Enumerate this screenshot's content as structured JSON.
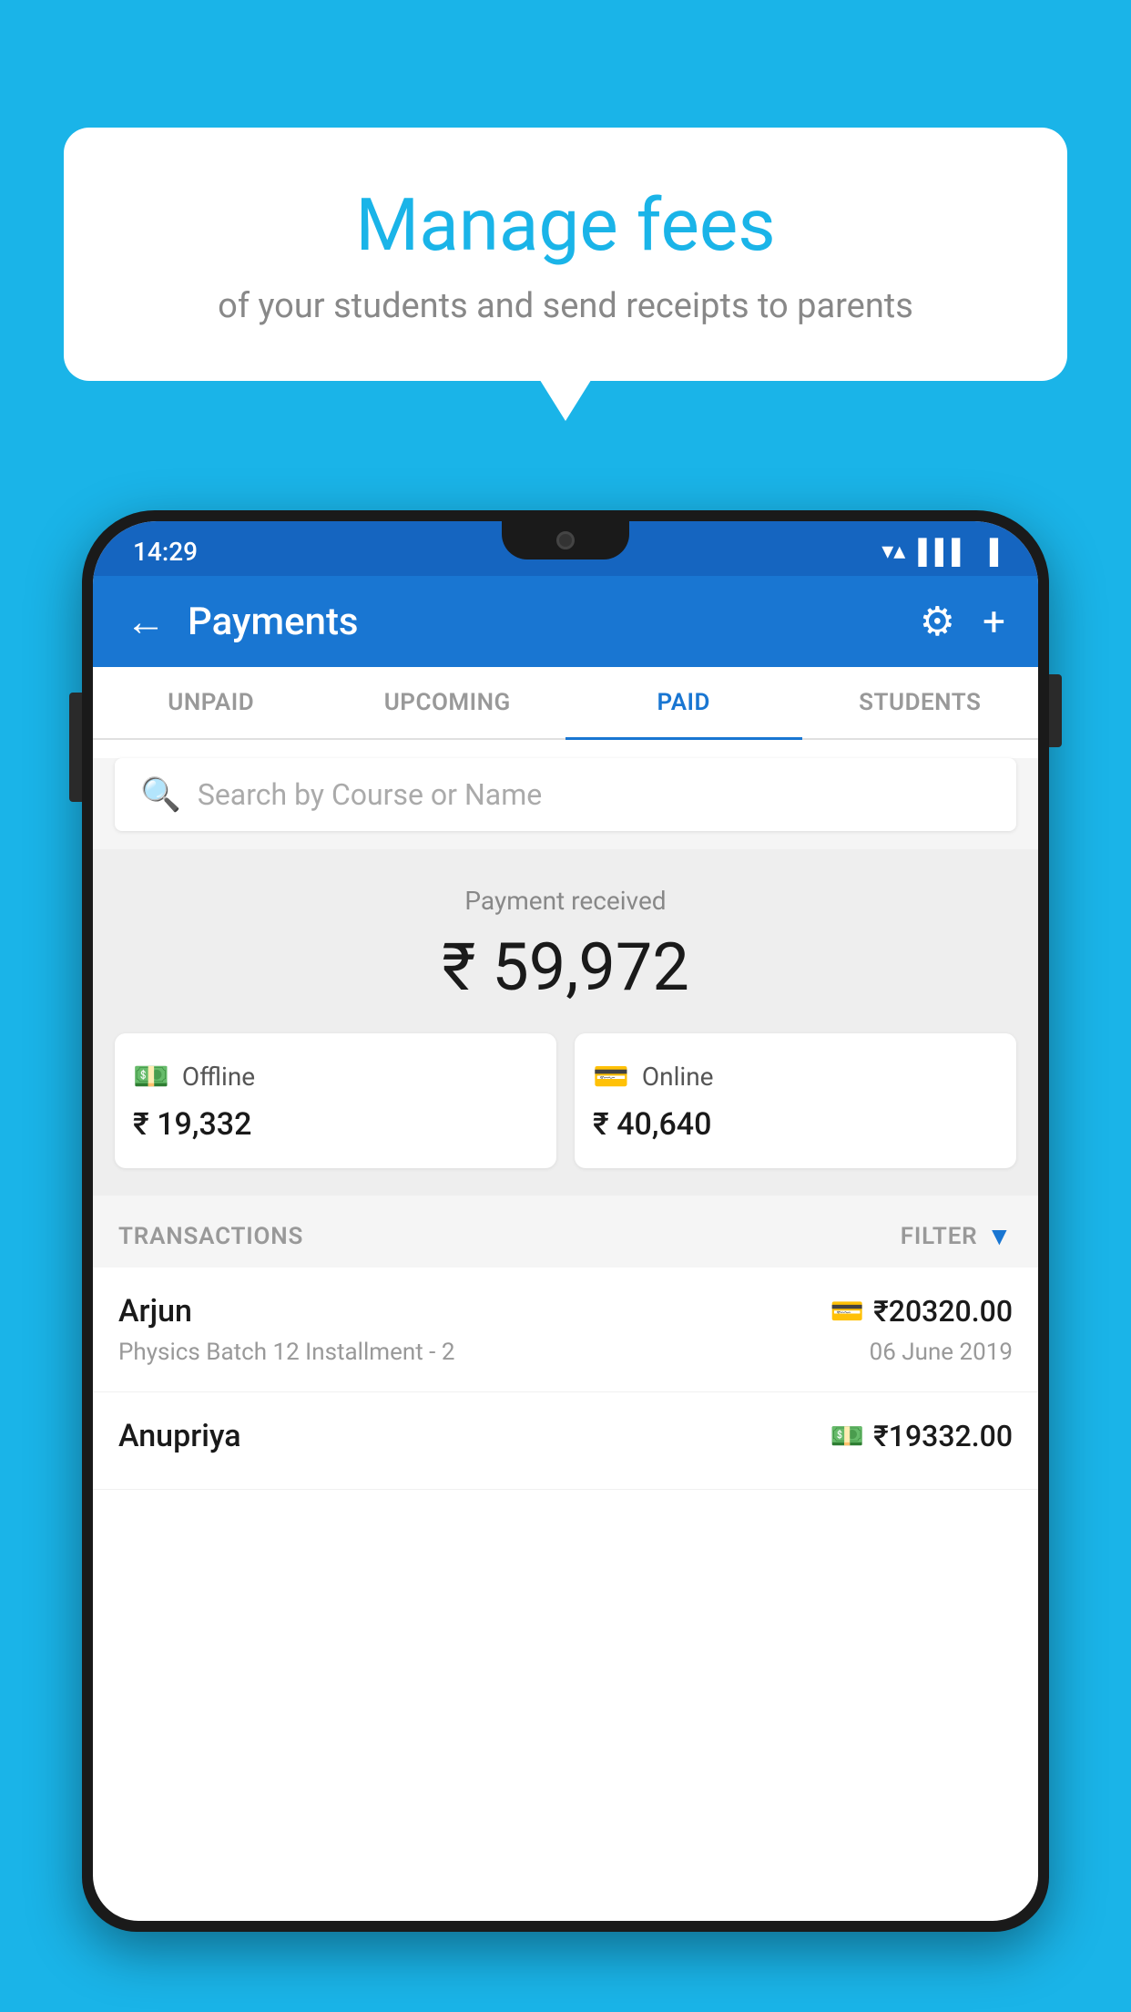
{
  "background_color": "#1ab4e8",
  "speech_bubble": {
    "title": "Manage fees",
    "subtitle": "of your students and send receipts to parents"
  },
  "status_bar": {
    "time": "14:29",
    "icons": [
      "wifi",
      "signal",
      "battery"
    ]
  },
  "header": {
    "title": "Payments",
    "back_label": "←",
    "gear_label": "⚙",
    "plus_label": "+"
  },
  "tabs": [
    {
      "label": "UNPAID",
      "active": false
    },
    {
      "label": "UPCOMING",
      "active": false
    },
    {
      "label": "PAID",
      "active": true
    },
    {
      "label": "STUDENTS",
      "active": false
    }
  ],
  "search": {
    "placeholder": "Search by Course or Name"
  },
  "payment_summary": {
    "label": "Payment received",
    "total": "₹ 59,972",
    "offline": {
      "label": "Offline",
      "amount": "₹ 19,332"
    },
    "online": {
      "label": "Online",
      "amount": "₹ 40,640"
    }
  },
  "transactions": {
    "label": "TRANSACTIONS",
    "filter_label": "FILTER",
    "rows": [
      {
        "name": "Arjun",
        "details": "Physics Batch 12 Installment - 2",
        "amount": "₹20320.00",
        "date": "06 June 2019",
        "icon": "card"
      },
      {
        "name": "Anupriya",
        "details": "",
        "amount": "₹19332.00",
        "date": "",
        "icon": "cash"
      }
    ]
  }
}
